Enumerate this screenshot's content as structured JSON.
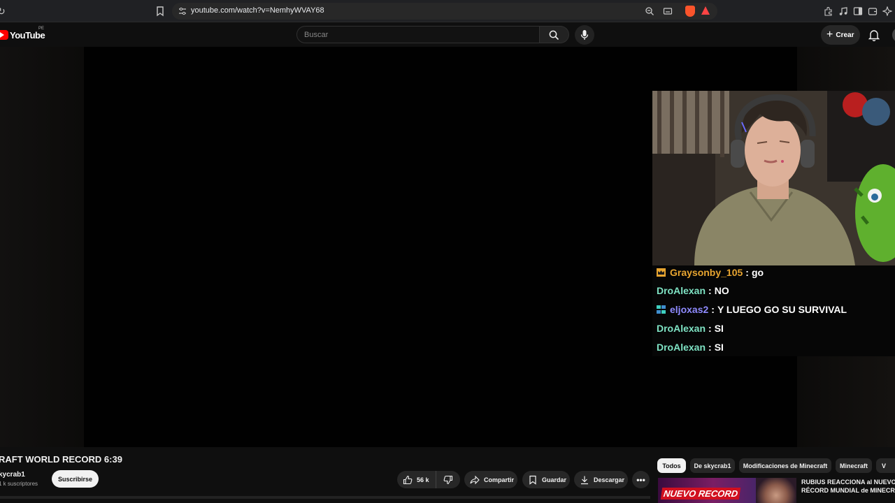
{
  "browser": {
    "url": "youtube.com/watch?v=NemhyWVAY68",
    "icons": [
      "reload-icon",
      "bookmark-icon",
      "site-settings-icon",
      "zoom-icon",
      "cast-icon",
      "brave-shields-icon",
      "brave-rewards-icon",
      "extensions-icon",
      "media-icon",
      "sidebar-icon",
      "wallet-icon",
      "leo-icon"
    ]
  },
  "masthead": {
    "logo_text": "YouTube",
    "country_code": "PE",
    "search_placeholder": "Buscar",
    "create_label": "Crear"
  },
  "chat": {
    "messages": [
      {
        "user": "Graysonby_105",
        "separator": ":",
        "text": "go",
        "user_color": "#e8a530",
        "badge": "crown-icon"
      },
      {
        "user": "DroAlexan",
        "separator": ":",
        "text": "NO",
        "user_color": "#7fe3c4",
        "badge": ""
      },
      {
        "user": "eljoxas2",
        "separator": ":",
        "text": "Y LUEGO GO SU SURVIVAL",
        "user_color": "#8f8bff",
        "badge": "sub-badge-icon"
      },
      {
        "user": "DroAlexan",
        "separator": ":",
        "text": "SI",
        "user_color": "#7fe3c4",
        "badge": ""
      },
      {
        "user": "DroAlexan",
        "separator": ":",
        "text": "SI",
        "user_color": "#7fe3c4",
        "badge": ""
      }
    ]
  },
  "video": {
    "title": "RAFT WORLD RECORD 6:39",
    "channel": "kycrab1",
    "subscribers": "1 k suscriptores",
    "subscribe_label": "Suscribirse",
    "likes": "56 k",
    "share_label": "Compartir",
    "save_label": "Guardar",
    "download_label": "Descargar",
    "more_label": "•••"
  },
  "chips": [
    "Todos",
    "De skycrab1",
    "Modificaciones de Minecraft",
    "Minecraft",
    "V"
  ],
  "recommended": {
    "thumb_text": "NUEVO RECORD",
    "title_line1": "RUBIUS REACCIONA al NUEVO",
    "title_line2": "RÉCORD MUNDIAL de MINECRAFT"
  },
  "colors": {
    "background": "#0f0f0f",
    "chip_active": "#f1f1f1",
    "youtube_red": "#ff0000"
  }
}
